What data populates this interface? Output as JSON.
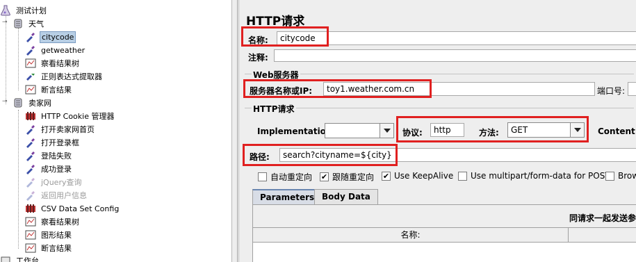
{
  "tree": {
    "root": "测试计划",
    "groups": [
      {
        "label": "天气",
        "items": [
          {
            "label": "citycode",
            "icon": "dropper-icon",
            "selected": true
          },
          {
            "label": "getweather",
            "icon": "dropper-icon"
          },
          {
            "label": "察看结果树",
            "icon": "result-tree-icon"
          },
          {
            "label": "正则表达式提取器",
            "icon": "regex-extractor-icon"
          },
          {
            "label": "断言结果",
            "icon": "assertion-result-icon"
          }
        ]
      },
      {
        "label": "卖家网",
        "items": [
          {
            "label": "HTTP Cookie 管理器",
            "icon": "cookie-manager-icon"
          },
          {
            "label": "打开卖家网首页",
            "icon": "dropper-icon"
          },
          {
            "label": "打开登录框",
            "icon": "dropper-icon"
          },
          {
            "label": "登陆失败",
            "icon": "dropper-icon"
          },
          {
            "label": "成功登录",
            "icon": "dropper-icon"
          },
          {
            "label": "jQuery查询",
            "icon": "dropper-icon",
            "disabled": true
          },
          {
            "label": "返回用户信息",
            "icon": "dropper-icon",
            "disabled": true
          },
          {
            "label": "CSV Data Set Config",
            "icon": "csv-config-icon"
          },
          {
            "label": "察看结果树",
            "icon": "result-tree-icon"
          },
          {
            "label": "图形结果",
            "icon": "graph-result-icon"
          },
          {
            "label": "断言结果",
            "icon": "assertion-result-icon"
          }
        ]
      }
    ],
    "workbench": "工作台"
  },
  "panel": {
    "title": "HTTP请求",
    "name_label": "名称:",
    "name_value": "citycode",
    "comment_label": "注释:",
    "comment_value": "",
    "web_server_title": "Web服务器",
    "server_label": "服务器名称或IP:",
    "server_value": "toy1.weather.com.cn",
    "port_label": "端口号:",
    "http_request_title": "HTTP请求",
    "implementation_label": "Implementation:",
    "implementation_value": "",
    "protocol_label": "协议:",
    "protocol_value": "http",
    "method_label": "方法:",
    "method_value": "GET",
    "content_encoding_label": "Content e",
    "path_label": "路径:",
    "path_value": "search?cityname=${city}",
    "checkboxes": [
      {
        "label": "自动重定向",
        "checked": false
      },
      {
        "label": "跟随重定向",
        "checked": true
      },
      {
        "label": "Use KeepAlive",
        "checked": true
      },
      {
        "label": "Use multipart/form-data for POST",
        "checked": false
      },
      {
        "label": "Brow",
        "checked": false
      }
    ],
    "tabs": [
      "Parameters",
      "Body Data"
    ],
    "params_caption": "同请求一起发送参",
    "params_column": "名称:"
  },
  "colors": {
    "highlight_box": "#e02020",
    "selection": "#b8cfe5",
    "panel_bg": "#eeeeee"
  }
}
